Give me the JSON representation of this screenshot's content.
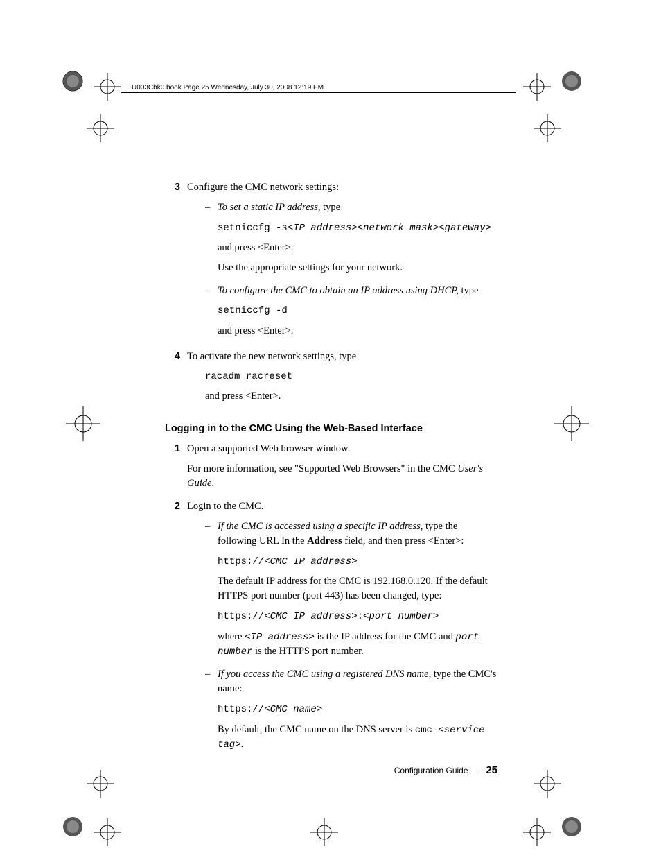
{
  "header": "U003Cbk0.book  Page 25  Wednesday, July 30, 2008  12:19 PM",
  "step3": {
    "num": "3",
    "text": "Configure the CMC network settings:",
    "a": {
      "lead": "To set a static IP address",
      "after": ", type",
      "cmd1": "setniccfg -s",
      "cmd2": "<IP address><network mask><gateway>",
      "press": "and press <Enter>.",
      "note": "Use the appropriate settings for your network."
    },
    "b": {
      "lead": "To configure the CMC to obtain an IP address using DHCP,",
      "after": " type",
      "cmd": "setniccfg -d",
      "press": "and press <Enter>."
    }
  },
  "step4": {
    "num": "4",
    "text": "To activate the new network settings, type",
    "cmd": "racadm racreset",
    "press": "and press <Enter>."
  },
  "heading": "Logging in to the CMC Using the Web-Based Interface",
  "step1": {
    "num": "1",
    "text": "Open a supported Web browser window.",
    "more1": "For more information, see \"Supported Web Browsers\" in the CMC ",
    "more2": "User's Guide",
    "more3": "."
  },
  "step2": {
    "num": "2",
    "text": "Login to the CMC.",
    "a": {
      "lead": "If the CMC is accessed using a specific IP address",
      "after1": ", type the following URL In the ",
      "bold": "Address",
      "after2": " field, and then press <Enter>:",
      "c1a": "https://",
      "c1b": "<CMC IP address>",
      "note": "The default IP address for the CMC is 192.168.0.120. If the default HTTPS port number (port 443) has been changed, type:",
      "c2a": "https://",
      "c2b": "<CMC IP address>",
      "c2c": ":",
      "c2d": "<port number>",
      "w1": "where ",
      "w2": "<IP address>",
      "w3": " is the IP address for the CMC and ",
      "w4": "port number",
      "w5": " is the HTTPS port number."
    },
    "b": {
      "lead": "If you access the CMC using a registered DNS name",
      "after": ", type the CMC's name:",
      "c1a": "https://",
      "c1b": "<CMC name>",
      "n1": "By default, the CMC name on the DNS server is ",
      "n2": "cmc-<",
      "n3": "service tag",
      "n4": ">",
      "n5": "."
    }
  },
  "footer": {
    "title": "Configuration Guide",
    "page": "25"
  }
}
